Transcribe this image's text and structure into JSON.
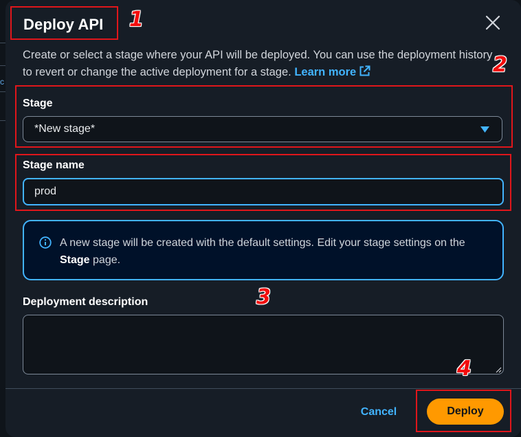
{
  "modal": {
    "title": "Deploy API",
    "close_icon": "close-icon",
    "description_text": "Create or select a stage where your API will be deployed. You can use the deployment history to revert or change the active deployment for a stage.",
    "learn_more_label": "Learn more",
    "learn_more_icon": "external-link-icon"
  },
  "stage_field": {
    "label": "Stage",
    "selected_value": "*New stage*",
    "caret_icon": "caret-down-icon"
  },
  "stage_name_field": {
    "label": "Stage name",
    "value": "prod"
  },
  "info_alert": {
    "icon": "info-icon",
    "text_before": "A new stage will be created with the default settings. Edit your stage settings on the",
    "text_bold": "Stage",
    "text_after": "page."
  },
  "deployment_description_field": {
    "label": "Deployment description",
    "value": ""
  },
  "footer": {
    "cancel_label": "Cancel",
    "deploy_label": "Deploy"
  },
  "annotations": {
    "step_1": "1",
    "step_2": "2",
    "step_3": "3",
    "step_4": "4"
  },
  "colors": {
    "modal_background": "#161d26",
    "accent_blue": "#42b4ff",
    "primary_button": "#ff9900",
    "annotation_red": "#e0161b",
    "alert_background": "#001129"
  }
}
